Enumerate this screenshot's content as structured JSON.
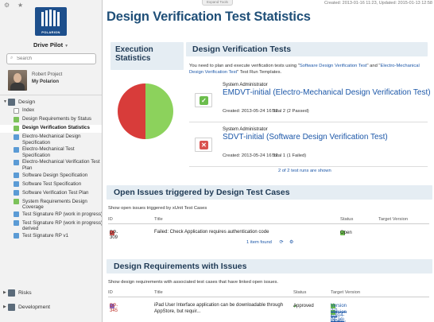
{
  "sidebar": {
    "project_name": "Drive Pilot",
    "logo_text": "POLARION",
    "search_placeholder": "Search",
    "user": {
      "name": "Robert Project",
      "link": "My Polarion"
    },
    "groups": [
      {
        "label": "Design",
        "expanded": true
      },
      {
        "label": "Risks",
        "expanded": false
      },
      {
        "label": "Development",
        "expanded": false
      }
    ],
    "items": [
      {
        "label": "Index",
        "icon": "document-icon"
      },
      {
        "label": "Design Requirements by Status",
        "icon": "report-icon-green"
      },
      {
        "label": "Design Verification Statistics",
        "icon": "report-icon-green",
        "active": true
      },
      {
        "label": "Electro-Mechanical Design Specification",
        "icon": "wiki-icon-blue"
      },
      {
        "label": "Electro-Mechanical Test Specification",
        "icon": "wiki-icon-blue"
      },
      {
        "label": "Electro-Mechanical Verification Test Plan",
        "icon": "wiki-icon-blue"
      },
      {
        "label": "Software Design Specification",
        "icon": "wiki-icon-blue"
      },
      {
        "label": "Software Test Specification",
        "icon": "wiki-icon-blue"
      },
      {
        "label": "Software Verification Test Plan",
        "icon": "wiki-icon-blue"
      },
      {
        "label": "System Requirements Design Coverage",
        "icon": "report-icon-green"
      },
      {
        "label": "Test Signature RP (work in progress)",
        "icon": "wiki-icon-blue"
      },
      {
        "label": "Test Signature RP (work in progress) derived",
        "icon": "wiki-icon-blue"
      },
      {
        "label": "Test Signature RP v1",
        "icon": "wiki-icon-blue"
      }
    ]
  },
  "toolbar": {
    "expand_tools": "Expand Tools"
  },
  "meta": "Created: 2013-01-16 11:23, Updated: 2015-01-13 12:58",
  "page_title": "Design Verification Test Statistics",
  "execution": {
    "title": "Execution Statistics",
    "pie": {
      "passed": 1,
      "failed": 1,
      "passed_color": "#8cd25c",
      "failed_color": "#d83c3a"
    }
  },
  "dvt": {
    "title": "Design Verification Tests",
    "intro_prefix": "You need to plan and execute verification tests using \"",
    "intro_link1": "Software Design Verification Test",
    "intro_mid": "\" and \"",
    "intro_link2": "Electro-Mechanical Design Verification Test",
    "intro_suffix": "\" Test Run Templates.",
    "runs": [
      {
        "by": "System Administrator",
        "title": "EMDVT-initial (Electro-Mechanical Design Verification Test)",
        "created": "Created: 2013-05-24 16:32",
        "total": "Total 2 (2 Passed)",
        "status": "passed",
        "icon": "check-icon"
      },
      {
        "by": "System Administrator",
        "title": "SDVT-initial (Software Design Verification Test)",
        "created": "Created: 2013-05-24 16:32",
        "total": "Total 1 (1 Failed)",
        "status": "failed",
        "icon": "cross-icon"
      }
    ],
    "shown": "2 of 2 test runs are shown"
  },
  "open_issues": {
    "title": "Open Issues triggered by Design Test Cases",
    "desc": "Show open issues triggered by xUnit Test Cases",
    "columns": [
      "ID",
      "Title",
      "Status",
      "Target Version"
    ],
    "rows": [
      {
        "id": "DP-309",
        "title": "Failed: Check Application requires authentication code",
        "status": "Open",
        "target": ""
      }
    ],
    "found": "1 item found"
  },
  "design_reqs": {
    "title": "Design Requirements with Issues",
    "desc": "Show design requirements with associated test cases that have linked open issues.",
    "columns": [
      "ID",
      "Title",
      "Status",
      "Target Version"
    ],
    "rows": [
      {
        "id": "DP-345",
        "title_line1": "iPad User Interface application can be downloadable through",
        "title_line2": "AppStore, but requir...",
        "status": "Approved",
        "target1": "Version 2.0 (2014-06-30),",
        "target2": "Version 1.0 (2013-12-27)"
      }
    ]
  }
}
